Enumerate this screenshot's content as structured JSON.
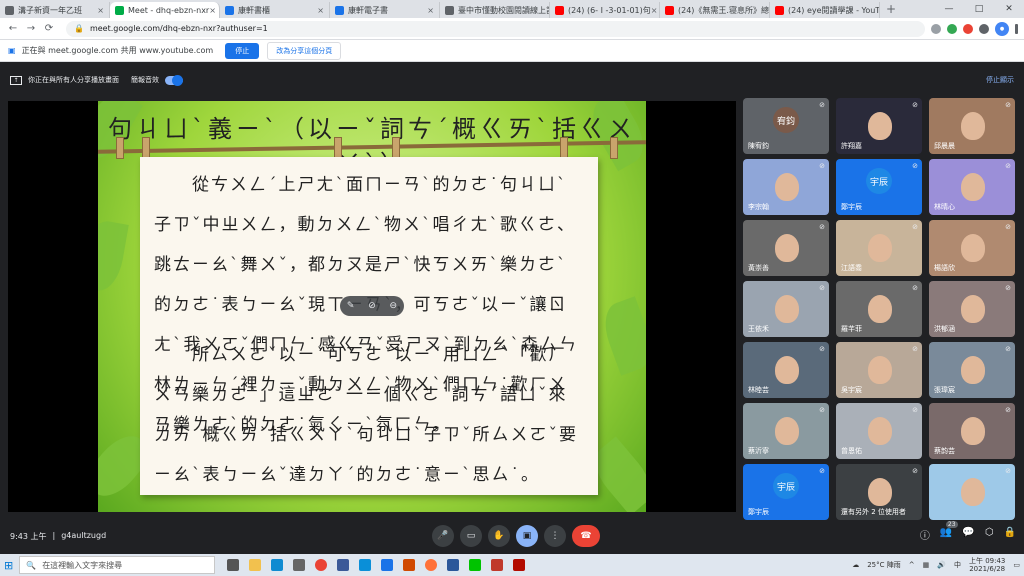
{
  "tabs": [
    {
      "label": "溝子新資一年乙班",
      "color": "#5f6368"
    },
    {
      "label": "Meet - dhq-ebzn-nxr",
      "color": "#00ac47",
      "active": true
    },
    {
      "label": "康軒書櫃",
      "color": "#1a73e8"
    },
    {
      "label": "康軒電子書",
      "color": "#1a73e8"
    },
    {
      "label": "臺中市懂動校園閱讀線上計",
      "color": "#5f6368"
    },
    {
      "label": "(24) (6- I -3-01-01)句",
      "color": "#ff0000"
    },
    {
      "label": "(24)《無需王.寝息所》總",
      "color": "#ff0000"
    },
    {
      "label": "(24) eye閱讀學課 - YouTu",
      "color": "#ff0000"
    }
  ],
  "address": {
    "url": "meet.google.com/dhq-ebzn-nxr?authuser=1"
  },
  "share_bar": {
    "text": "正在與 meet.google.com 共用 www.youtube.com",
    "stop": "停止",
    "change": "改為分享這個分頁"
  },
  "pres_bar": {
    "text": "你正在與所有人分享播放畫面",
    "audio": "簡報音效",
    "stop": "停止顯示"
  },
  "slide": {
    "title": "句ㄐㄩˋ義ㄧˋ（以ㄧˇ詞ㄘˊ概ㄍㄞˋ括ㄍㄨㄚˋ）",
    "para1": "　　從ㄘㄨㄥˊ上ㄕㄤˋ面ㄇㄧㄢˋ的ㄉㄜ˙句ㄐㄩˋ子ㄗˇ中ㄓㄨㄥ，動ㄉㄨㄥˋ物ㄨˋ唱ㄔㄤˋ歌ㄍㄜ、跳ㄊㄧㄠˋ舞ㄨˇ，都ㄉㄡ是ㄕˋ快ㄎㄨㄞˋ樂ㄌㄜˋ的ㄉㄜ˙表ㄅㄧㄠˇ現ㄒㄧㄢˋ，可ㄎㄜˇ以ㄧˇ讓ㄖㄤˋ我ㄨㄛˇ們ㄇㄣ˙感ㄍㄢˇ受ㄕㄡˋ到ㄉㄠˋ森ㄙㄣ林ㄌㄧㄣˊ裡ㄌㄧˇ動ㄉㄨㄥˋ物ㄨˋ們ㄇㄣ˙歡ㄏㄨㄢ樂ㄌㄜˋ的ㄉㄜ˙氣ㄑㄧˋ氛ㄈㄣ。",
    "para2": "　　所ㄙㄨㄛˇ以ㄧˇ可ㄎㄜˇ以ㄧˇ用ㄩㄥˋ「歡ㄏㄨㄢ樂ㄌㄜˋ」這ㄓㄜˋ一ㄧ個ㄍㄜ˙詞ㄘˊ語ㄩˇ來ㄌㄞˊ概ㄍㄞˋ括ㄍㄨㄚˋ句ㄐㄩˋ子ㄗˇ所ㄙㄨㄛˇ要ㄧㄠˋ表ㄅㄧㄠˇ達ㄉㄚˊ的ㄉㄜ˙意ㄧˋ思ㄙ˙。"
  },
  "participants": [
    {
      "name": "陳宥鈞",
      "avatar": "宥鈞",
      "color": "#5f6368"
    },
    {
      "name": "許翔嘉",
      "color": "#2a2a3a"
    },
    {
      "name": "邱晨晨",
      "color": "#a07a60"
    },
    {
      "name": "李宗翰",
      "color": "#8fa6d8"
    },
    {
      "name": "鄭宇辰",
      "avatar": "宇辰",
      "color": "#1a73e8"
    },
    {
      "name": "林晴心",
      "color": "#9b8fd8"
    },
    {
      "name": "黃崇善",
      "color": "#6a6a6a"
    },
    {
      "name": "江語喬",
      "color": "#c8b49a"
    },
    {
      "name": "楊語欣",
      "color": "#b08a70"
    },
    {
      "name": "王依禾",
      "color": "#9aa4b0"
    },
    {
      "name": "羅芊菲",
      "color": "#6a6a6a"
    },
    {
      "name": "洪郁涵",
      "color": "#8a7a7a"
    },
    {
      "name": "林睦芸",
      "color": "#5a6a7a"
    },
    {
      "name": "吳宇宸",
      "color": "#b8a898"
    },
    {
      "name": "張瑋宸",
      "color": "#7a8a9a"
    },
    {
      "name": "蔡沂寧",
      "color": "#8a9aa0"
    },
    {
      "name": "曾恩佑",
      "color": "#aab0b8"
    },
    {
      "name": "蔡韵芸",
      "color": "#7a6a6a"
    },
    {
      "name": "鄭宇辰",
      "avatar": "宇辰",
      "color": "#1a73e8"
    },
    {
      "name": "還有另外 2 位使用者",
      "color": "#3c4043"
    },
    {
      "name": "",
      "color": "#9ec9e8"
    }
  ],
  "meeting": {
    "time": "9:43 上午",
    "code": "g4aultzugd",
    "participant_count": "23"
  },
  "taskbar": {
    "search": "在這裡輸入文字來搜尋",
    "weather": "25°C 陣雨",
    "time": "上午 09:43",
    "date": "2021/6/28",
    "lang": "中"
  }
}
